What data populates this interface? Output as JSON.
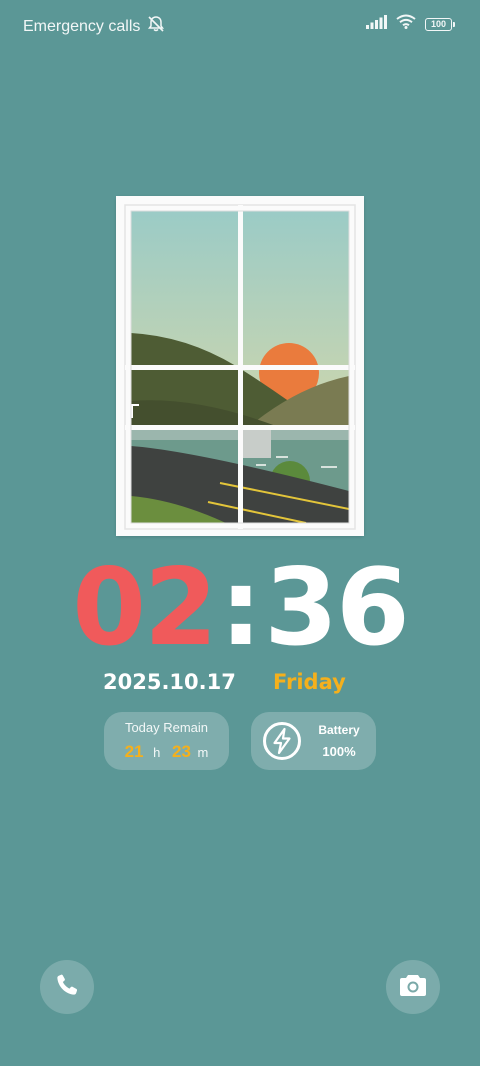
{
  "status_bar": {
    "carrier_text": "Emergency calls",
    "mute_icon": "bell-slash-icon",
    "signal_icon": "signal-bars-icon",
    "wifi_icon": "wifi-icon",
    "battery_level": "100"
  },
  "wallpaper": {
    "description_icon": "window-landscape-illustration",
    "colors": {
      "sky": "#9dcbc6",
      "sun": "#ea7b3d",
      "mountain": "#4d5c34",
      "road": "#3f4240"
    }
  },
  "clock": {
    "hours": "02",
    "separator": ":",
    "minutes": "36"
  },
  "date": {
    "date_text": "2025.10.17",
    "day_text": "Friday"
  },
  "widgets": {
    "today_remain": {
      "title": "Today Remain",
      "hours": "21",
      "hours_unit": "h",
      "minutes": "23",
      "minutes_unit": "m"
    },
    "battery": {
      "icon": "lightning-bolt-icon",
      "title": "Battery",
      "value": "100%"
    }
  },
  "shortcuts": {
    "left_icon": "phone-icon",
    "right_icon": "camera-icon"
  },
  "colors": {
    "background": "#5b9796",
    "accent_red": "#f05a5b",
    "accent_yellow": "#f5b01c"
  }
}
